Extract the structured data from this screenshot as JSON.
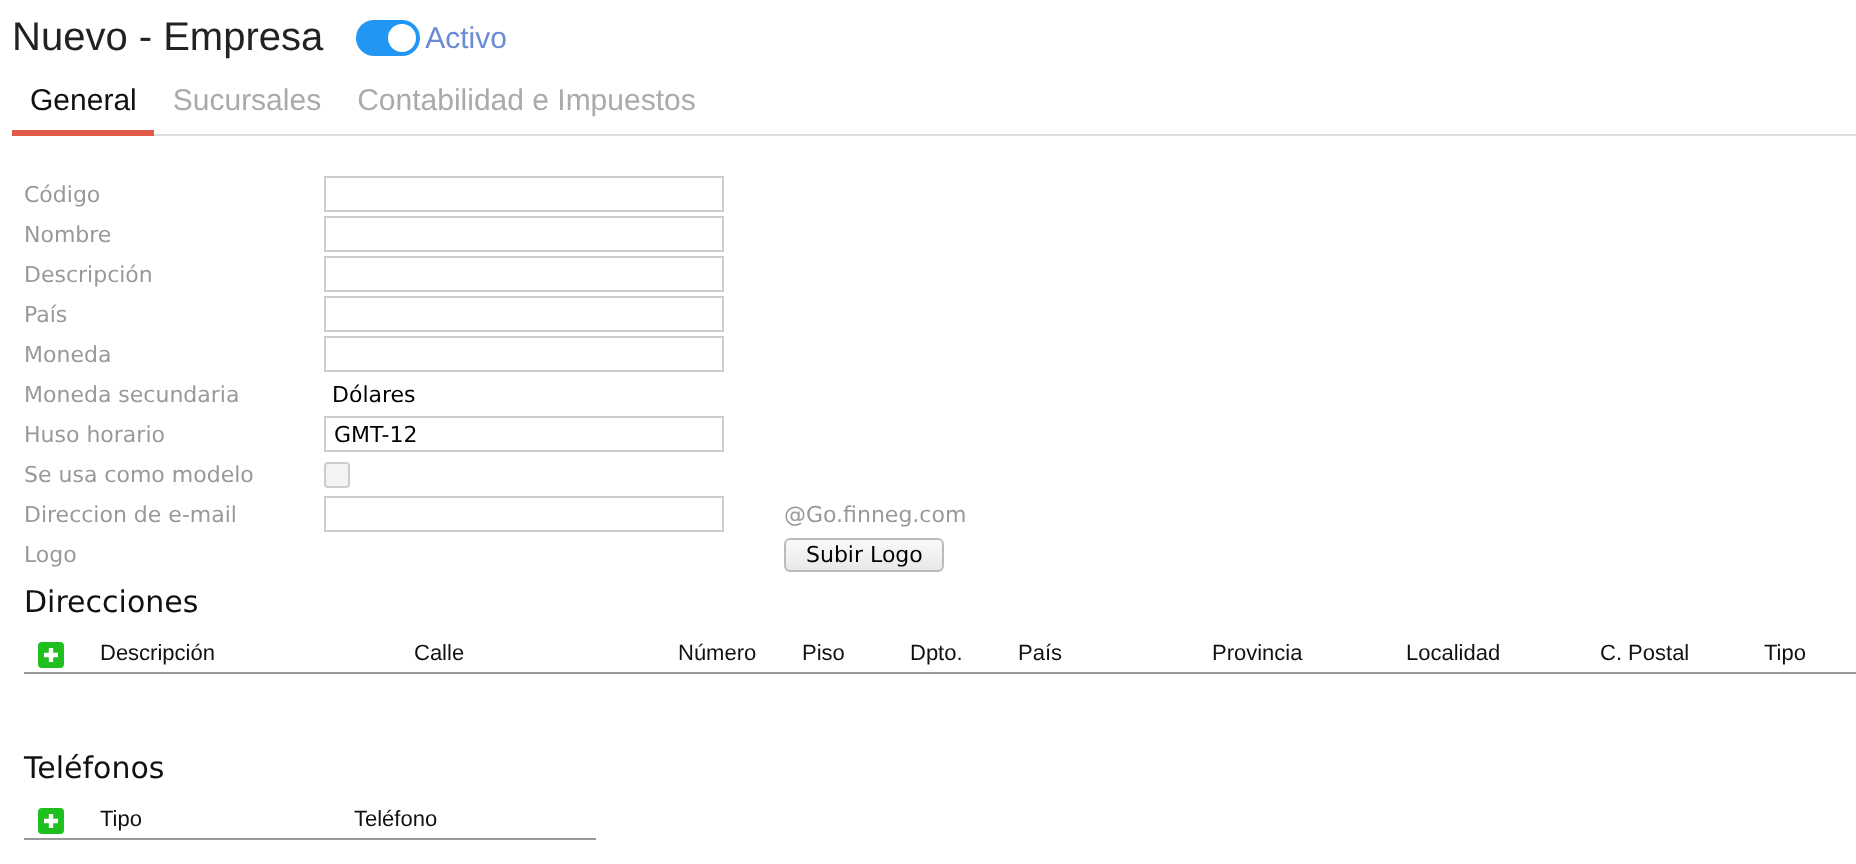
{
  "header": {
    "title": "Nuevo - Empresa",
    "toggle": {
      "label": "Activo",
      "on": true
    }
  },
  "tabs": [
    {
      "label": "General",
      "selected": true
    },
    {
      "label": "Sucursales",
      "selected": false
    },
    {
      "label": "Contabilidad e Impuestos",
      "selected": false
    }
  ],
  "form": [
    {
      "label": "Código",
      "kind": "input"
    },
    {
      "label": "Nombre",
      "kind": "input"
    },
    {
      "label": "Descripción",
      "kind": "input"
    },
    {
      "label": "País",
      "kind": "input"
    },
    {
      "label": "Moneda",
      "kind": "input"
    },
    {
      "label": "Moneda secundaria",
      "kind": "text",
      "value": "Dólares"
    },
    {
      "label": "Huso horario",
      "kind": "input",
      "value": "GMT-12"
    },
    {
      "label": "Se usa como modelo",
      "kind": "checkbox",
      "checked": false
    },
    {
      "label": "Direccion de e-mail",
      "kind": "email",
      "suffix": "@Go.finneg.com"
    },
    {
      "label": "Logo",
      "kind": "button",
      "button": "Subir Logo"
    }
  ],
  "sections": [
    {
      "title": "Direcciones",
      "columns": [
        "Descripción",
        "Calle",
        "Número",
        "Piso",
        "Dpto.",
        "País",
        "Provincia",
        "Localidad",
        "C. Postal",
        "Tipo"
      ]
    },
    {
      "title": "Teléfonos",
      "columns": [
        "Tipo",
        "Teléfono"
      ]
    }
  ]
}
